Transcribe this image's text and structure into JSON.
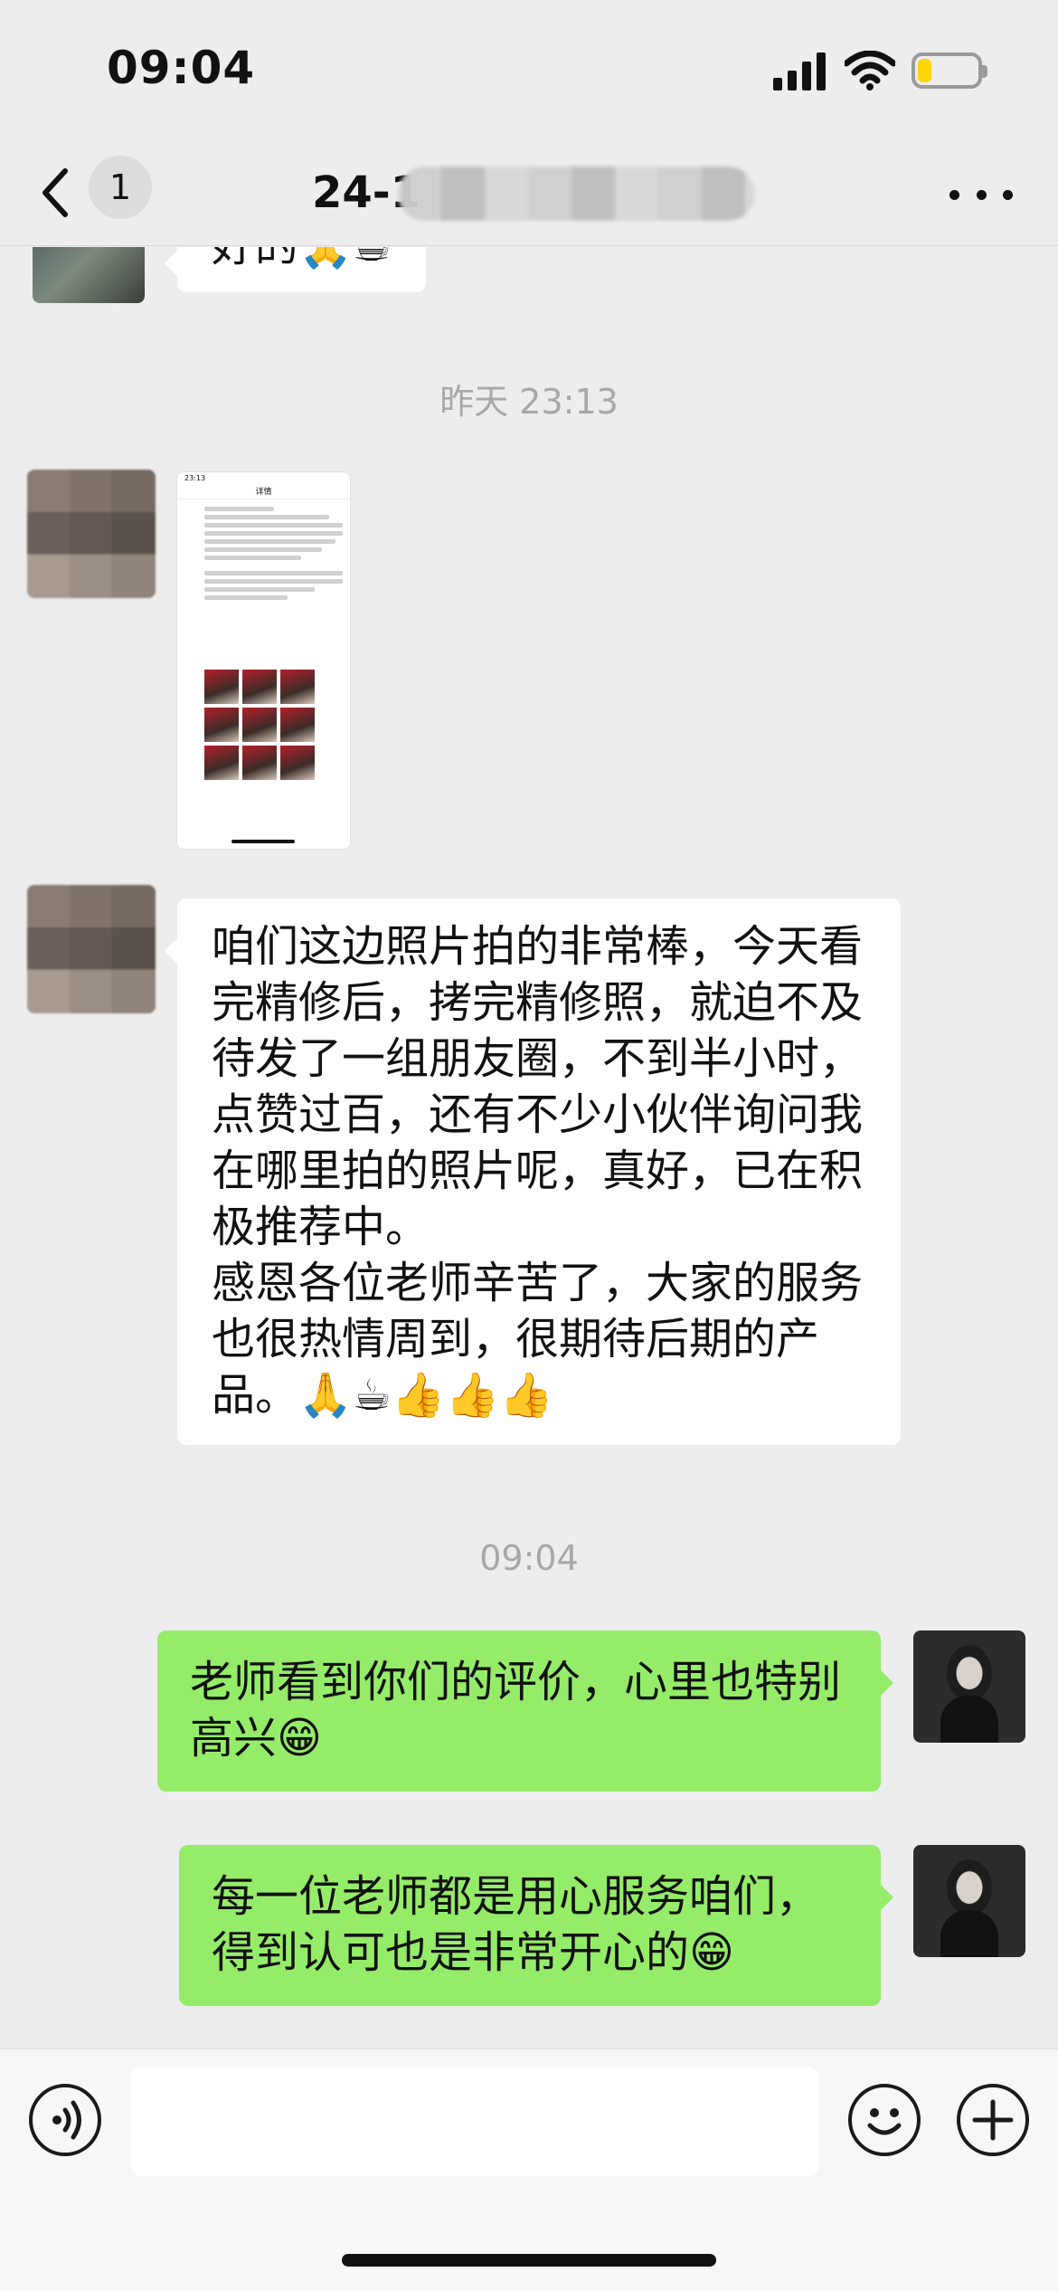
{
  "status_bar": {
    "time": "09:04",
    "battery_level": 0.22,
    "battery_color": "#ffd60a"
  },
  "nav": {
    "unread_count": "1",
    "title_visible": "24-1",
    "back_icon": "chevron-left-icon",
    "more_icon": "ellipsis-icon"
  },
  "messages": {
    "top_partial": "好的🙏☕",
    "time_1": "昨天 23:13",
    "image_caption_title": "详情",
    "long_text": "咱们这边照片拍的非常棒，今天看完精修后，拷完精修照，就迫不及待发了一组朋友圈，不到半小时，点赞过百，还有不少小伙伴询问我在哪里拍的照片呢，真好，已在积极推荐中。\n感恩各位老师辛苦了，大家的服务也很热情周到，很期待后期的产品。🙏☕👍👍👍",
    "time_2": "09:04",
    "reply_1": "老师看到你们的评价，心里也特别高兴😁",
    "reply_2": "每一位老师都是用心服务咱们，得到认可也是非常开心的😁"
  },
  "input_bar": {
    "voice_icon": "voice-icon",
    "emoji_icon": "emoji-icon",
    "plus_icon": "plus-icon",
    "placeholder": ""
  },
  "colors": {
    "bg": "#ededed",
    "outgoing": "#95ec69",
    "incoming": "#ffffff"
  }
}
